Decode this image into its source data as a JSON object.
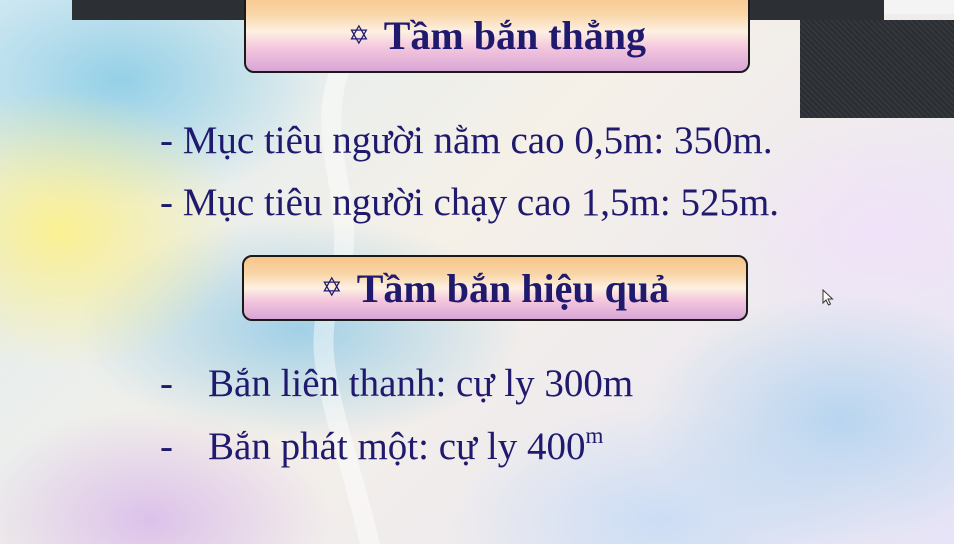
{
  "slide": {
    "star_symbol": "✡",
    "heading_1": "Tầm bắn thẳng",
    "heading_2": "Tầm bắn hiệu quả",
    "dash": "-",
    "lines_1": [
      "- Mục tiêu người nằm cao 0,5m: 350m.",
      "- Mục tiêu người chạy cao 1,5m: 525m."
    ],
    "lines_2": [
      {
        "text": "Bắn liên thanh: cự ly 300m"
      },
      {
        "text": "Bắn phát một: cự ly 400",
        "sup": "m"
      }
    ],
    "text_color": "#1f1a6e"
  },
  "icons": {
    "cursor": "mouse-pointer-icon"
  }
}
